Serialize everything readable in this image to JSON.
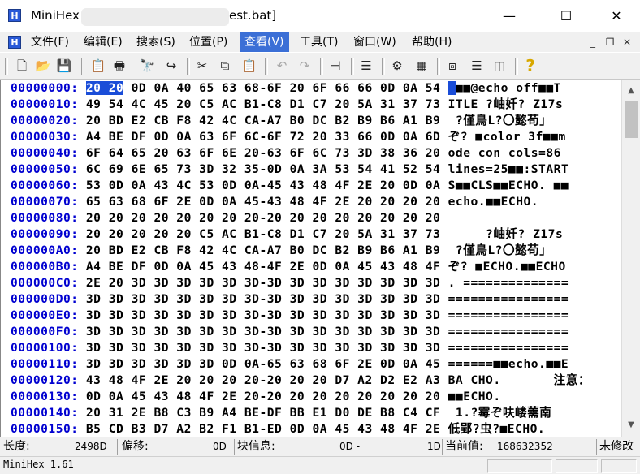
{
  "window": {
    "title_prefix": "MiniHex",
    "title_suffix": "est.bat]",
    "minimize": "—",
    "maximize": "☐",
    "close": "✕"
  },
  "menu": {
    "items": [
      "文件(F)",
      "编辑(E)",
      "搜索(S)",
      "位置(P)",
      "查看(V)",
      "工具(T)",
      "窗口(W)",
      "帮助(H)"
    ],
    "active_index": 4,
    "mdi_minimize": "_",
    "mdi_restore": "❐",
    "mdi_close": "✕"
  },
  "toolbar": {
    "buttons": [
      {
        "name": "new-file-icon",
        "glyph": "🗋"
      },
      {
        "name": "open-folder-icon",
        "glyph": "📂"
      },
      {
        "name": "save-icon",
        "glyph": "💾"
      },
      {
        "name": "properties-icon",
        "glyph": "📋"
      },
      {
        "name": "print-icon",
        "glyph": "🖶"
      },
      {
        "name": "find-icon",
        "glyph": "🔭"
      },
      {
        "name": "goto-icon",
        "glyph": "↪"
      },
      {
        "name": "cut-icon",
        "glyph": "✂"
      },
      {
        "name": "copy-icon",
        "glyph": "⧉"
      },
      {
        "name": "paste-icon",
        "glyph": "📋"
      },
      {
        "name": "undo-icon",
        "glyph": "↶"
      },
      {
        "name": "redo-icon",
        "glyph": "↷"
      },
      {
        "name": "pin-icon",
        "glyph": "⊣"
      },
      {
        "name": "view-text-icon",
        "glyph": "☰"
      },
      {
        "name": "settings-icon",
        "glyph": "⚙"
      },
      {
        "name": "calculator-icon",
        "glyph": "▦"
      },
      {
        "name": "cascade-icon",
        "glyph": "⧈"
      },
      {
        "name": "tile-horizontal-icon",
        "glyph": "☰"
      },
      {
        "name": "tile-vertical-icon",
        "glyph": "◫"
      },
      {
        "name": "help-icon",
        "glyph": "?"
      }
    ]
  },
  "hex": {
    "rows": [
      {
        "offset": "00000000:",
        "sel": "20 20",
        "bytes": " 0D 0A 40 65 63 68-6F 20 6F 66 66 0D 0A 54",
        "ascii_sel": " ",
        "ascii": "■■@echo off■■T"
      },
      {
        "offset": "00000010:",
        "bytes": "49 54 4C 45 20 C5 AC B1-C8 D1 C7 20 5A 31 37 73",
        "ascii": "ITLE ?岫奷? Z17s"
      },
      {
        "offset": "00000020:",
        "bytes": "20 BD E2 CB F8 42 4C CA-A7 B0 DC B2 B9 B6 A1 B9",
        "ascii": " ?僅鳥L?〇懿苟」"
      },
      {
        "offset": "00000030:",
        "bytes": "A4 BE DF 0D 0A 63 6F 6C-6F 72 20 33 66 0D 0A 6D",
        "ascii": "ぞ? ■color 3f■■m"
      },
      {
        "offset": "00000040:",
        "bytes": "6F 64 65 20 63 6F 6E 20-63 6F 6C 73 3D 38 36 20",
        "ascii": "ode con cols=86"
      },
      {
        "offset": "00000050:",
        "bytes": "6C 69 6E 65 73 3D 32 35-0D 0A 3A 53 54 41 52 54",
        "ascii": "lines=25■■:START"
      },
      {
        "offset": "00000060:",
        "bytes": "53 0D 0A 43 4C 53 0D 0A-45 43 48 4F 2E 20 0D 0A",
        "ascii": "S■■CLS■■ECHO. ■■"
      },
      {
        "offset": "00000070:",
        "bytes": "65 63 68 6F 2E 0D 0A 45-43 48 4F 2E 20 20 20 20",
        "ascii": "echo.■■ECHO.    "
      },
      {
        "offset": "00000080:",
        "bytes": "20 20 20 20 20 20 20 20-20 20 20 20 20 20 20 20",
        "ascii": ""
      },
      {
        "offset": "00000090:",
        "bytes": "20 20 20 20 20 C5 AC B1-C8 D1 C7 20 5A 31 37 73",
        "ascii": "     ?岫奷? Z17s"
      },
      {
        "offset": "000000A0:",
        "bytes": "20 BD E2 CB F8 42 4C CA-A7 B0 DC B2 B9 B6 A1 B9",
        "ascii": " ?僅鳥L?〇懿苟」"
      },
      {
        "offset": "000000B0:",
        "bytes": "A4 BE DF 0D 0A 45 43 48-4F 2E 0D 0A 45 43 48 4F",
        "ascii": "ぞ? ■ECHO.■■ECHO"
      },
      {
        "offset": "000000C0:",
        "bytes": "2E 20 3D 3D 3D 3D 3D 3D-3D 3D 3D 3D 3D 3D 3D 3D",
        "ascii": ". =============="
      },
      {
        "offset": "000000D0:",
        "bytes": "3D 3D 3D 3D 3D 3D 3D 3D-3D 3D 3D 3D 3D 3D 3D 3D",
        "ascii": "================"
      },
      {
        "offset": "000000E0:",
        "bytes": "3D 3D 3D 3D 3D 3D 3D 3D-3D 3D 3D 3D 3D 3D 3D 3D",
        "ascii": "================"
      },
      {
        "offset": "000000F0:",
        "bytes": "3D 3D 3D 3D 3D 3D 3D 3D-3D 3D 3D 3D 3D 3D 3D 3D",
        "ascii": "================"
      },
      {
        "offset": "00000100:",
        "bytes": "3D 3D 3D 3D 3D 3D 3D 3D-3D 3D 3D 3D 3D 3D 3D 3D",
        "ascii": "================"
      },
      {
        "offset": "00000110:",
        "bytes": "3D 3D 3D 3D 3D 3D 0D 0A-65 63 68 6F 2E 0D 0A 45",
        "ascii": "======■■echo.■■E"
      },
      {
        "offset": "00000120:",
        "bytes": "43 48 4F 2E 20 20 20 20-20 20 20 D7 A2 D2 E2 A3 BA",
        "ascii": "CHO.       注意："
      },
      {
        "offset": "00000130:",
        "bytes": "0D 0A 45 43 48 4F 2E 20-20 20 20 20 20 20 20 20",
        "ascii": "■■ECHO.         "
      },
      {
        "offset": "00000140:",
        "bytes": "20 31 2E B8 C3 B9 A4 BE-DF BB E1 D0 DE B8 C4 CF",
        "ascii": " 1.?霉ぞ呋嵝薷南"
      },
      {
        "offset": "00000150:",
        "bytes": "B5 CD B3 D7 A2 B2 F1 B1-ED 0D 0A 45 43 48 4F 2E",
        "ascii": "低郢?虫?■ECHO."
      }
    ]
  },
  "status": {
    "length_label": "长度:",
    "length_value": "2498D",
    "offset_label": "偏移:",
    "offset_value": "0D",
    "block_label": "块信息:",
    "block_value": "0D -",
    "block_end": "1D",
    "current_label": "当前值:",
    "current_value": "168632352",
    "modified": "未修改"
  },
  "bottom": {
    "version": "MiniHex 1.61"
  },
  "colors": {
    "offset": "#0000d0",
    "selection": "#1a4dd8",
    "menu_active": "#3b6fd6"
  }
}
